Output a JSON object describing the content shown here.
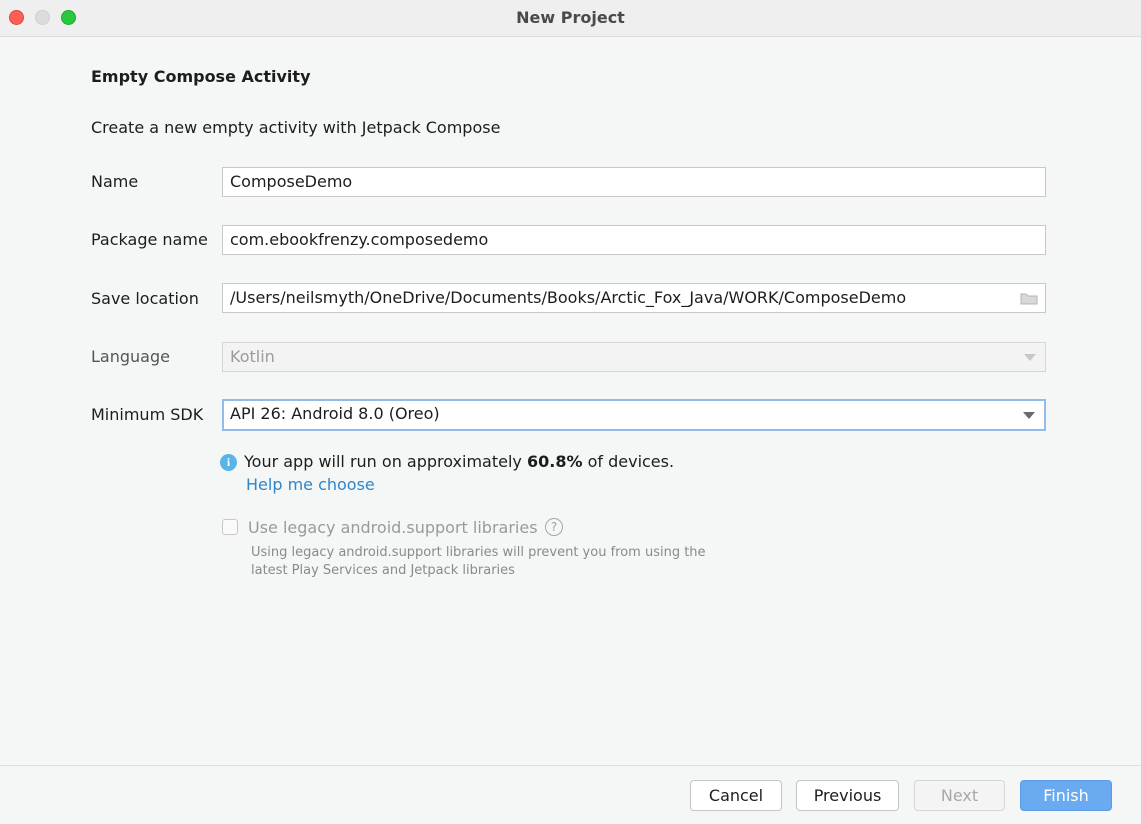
{
  "window": {
    "title": "New Project"
  },
  "page": {
    "heading": "Empty Compose Activity",
    "description": "Create a new empty activity with Jetpack Compose"
  },
  "form": {
    "name": {
      "label": "Name",
      "value": "ComposeDemo"
    },
    "package": {
      "label": "Package name",
      "value": "com.ebookfrenzy.composedemo"
    },
    "save_location": {
      "label": "Save location",
      "value": "/Users/neilsmyth/OneDrive/Documents/Books/Arctic_Fox_Java/WORK/ComposeDemo",
      "icon": "folder-icon"
    },
    "language": {
      "label": "Language",
      "value": "Kotlin"
    },
    "min_sdk": {
      "label": "Minimum SDK",
      "value": "API 26: Android 8.0 (Oreo)"
    }
  },
  "info": {
    "icon": "info-icon",
    "prefix": "Your app will run on approximately ",
    "percent": "60.8%",
    "suffix": " of devices.",
    "help_link": "Help me choose"
  },
  "legacy": {
    "checked": false,
    "label": "Use legacy android.support libraries",
    "help_glyph": "?",
    "note_line1": "Using legacy android.support libraries will prevent you from using the",
    "note_line2": "latest Play Services and Jetpack libraries"
  },
  "buttons": {
    "cancel": "Cancel",
    "previous": "Previous",
    "next": "Next",
    "finish": "Finish"
  },
  "colors": {
    "accent": "#6aaaf0",
    "link": "#2f86c9",
    "info": "#59b4e8"
  }
}
